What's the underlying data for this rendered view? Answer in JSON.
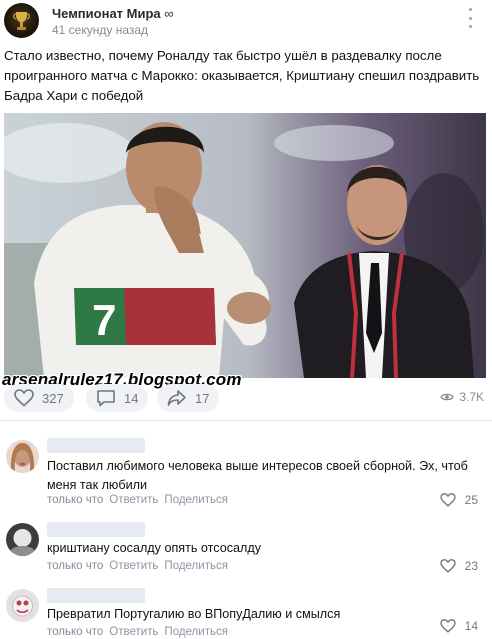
{
  "post": {
    "group_name": "Чемпионат Мира",
    "group_badge": "∞",
    "time": "41 секунду назад",
    "text": "Стало известно, почему Роналду так быстро ушёл в раздевалку после проигранного матча с Марокко: оказывается, Криштиану спешил поздравить Бадра Хари с победой",
    "photo_jersey_number": "7",
    "watermark": "arsenalrulez17.blogspot.com"
  },
  "actions": {
    "likes": "327",
    "comments": "14",
    "shares": "17",
    "views": "3.7K"
  },
  "comments": [
    {
      "text": "Поставил любимого человека выше интересов своей сборной. Эх, чтоб меня так любили",
      "time": "только что",
      "reply": "Ответить",
      "share": "Поделиться",
      "likes": "25"
    },
    {
      "text": "криштиану сосалду опять отсосалду",
      "time": "только что",
      "reply": "Ответить",
      "share": "Поделиться",
      "likes": "23"
    },
    {
      "text": "Превратил Португалию во ВПопуДалию и смылся",
      "time": "только что",
      "reply": "Ответить",
      "share": "Поделиться",
      "likes": "14"
    }
  ],
  "colors": {
    "link_gray": "#818c99",
    "button_bg": "#f0f2f5",
    "name_placeholder": "#e5ebf1"
  },
  "icons": [
    "trophy-icon",
    "more-icon",
    "heart-icon",
    "comment-icon",
    "share-icon",
    "eye-icon"
  ]
}
